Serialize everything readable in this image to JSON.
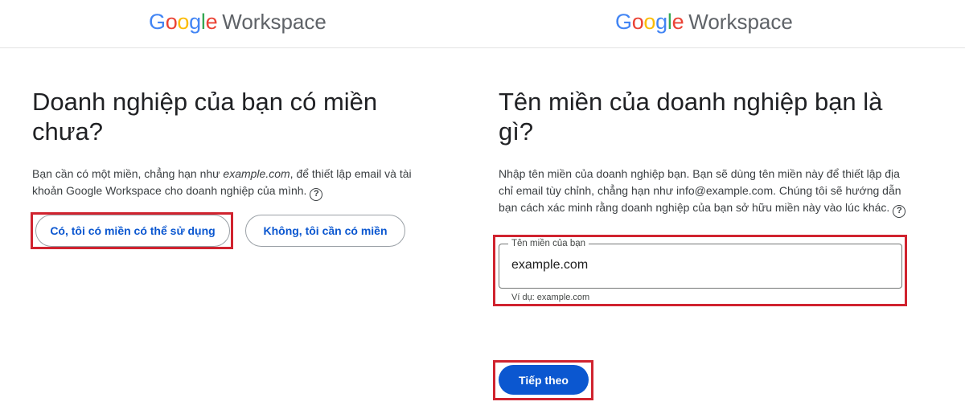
{
  "brand": {
    "google": [
      "G",
      "o",
      "o",
      "g",
      "l",
      "e"
    ],
    "product": "Workspace"
  },
  "left": {
    "title": "Doanh nghiệp của bạn có miền chưa?",
    "desc_before": "Bạn cần có một miền, chẳng hạn như ",
    "desc_example": "example.com",
    "desc_after": ", để thiết lập email và tài khoản Google Workspace cho doanh nghiệp của mình.",
    "yes_label": "Có, tôi có miền có thể sử dụng",
    "no_label": "Không, tôi cần có miền"
  },
  "right": {
    "title": "Tên miền của doanh nghiệp bạn là gì?",
    "desc": "Nhập tên miền của doanh nghiệp bạn. Bạn sẽ dùng tên miền này để thiết lập địa chỉ email tùy chỉnh, chẳng hạn như info@example.com. Chúng tôi sẽ hướng dẫn bạn cách xác minh rằng doanh nghiệp của bạn sở hữu miền này vào lúc khác.",
    "field_label": "Tên miền của bạn",
    "field_value": "example.com",
    "hint": "Ví dụ: example.com",
    "next_label": "Tiếp theo"
  },
  "help_glyph": "?",
  "colors": {
    "accent": "#0b57d0",
    "highlight": "#d0232f"
  },
  "icons": {
    "help": "question-circle-icon"
  }
}
